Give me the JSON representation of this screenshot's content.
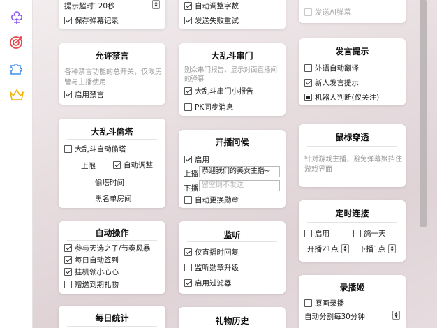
{
  "sidebar": {
    "icons": [
      "flower-icon",
      "target-icon",
      "puzzle-icon",
      "crown-icon"
    ]
  },
  "top_card_1": {
    "timeout_label": "提示超时120秒",
    "save_record": "保存弹幕记录"
  },
  "top_card_2": {
    "auto_adjust": "自动调整字数",
    "retry_failed": "发送失败重试"
  },
  "top_card_3": {
    "send_ai": "发送AI弹幕"
  },
  "allow_ban": {
    "title": "允许禁言",
    "desc": "各种禁言功能的总开关，仅限房管与主播使用",
    "enable": "启用禁言"
  },
  "chaos_door": {
    "title": "大乱斗串门",
    "desc": "别众串门报告、显示对面直播间的弹幕",
    "report": "大乱斗串门小报告",
    "pk_sync": "PK同步消息"
  },
  "speak_tip": {
    "title": "发言提示",
    "translate": "外语自动翻译",
    "new_user": "新人发言提示",
    "robot": "机器人判断(仅关注)"
  },
  "chaos_tower": {
    "title": "大乱斗偷塔",
    "auto": "大乱斗自动偷塔",
    "upper": "上限",
    "auto_adjust": "自动调整",
    "tower_time": "偷塔时间",
    "blacklist": "黑名单房间"
  },
  "greet": {
    "title": "开播问候",
    "enable": "启用",
    "up_label": "上播",
    "up_value": "恭迎我们的美女主播~",
    "down_label": "下播",
    "down_placeholder": "留空则不发送",
    "auto_medal": "自动更换勋章"
  },
  "mouse_through": {
    "title": "鼠标穿透",
    "desc": "针对游戏主播，避免弹幕姬挡住游戏界面"
  },
  "auto_ops": {
    "title": "自动操作",
    "lottery": "参与天选之子/节奏风暴",
    "sign": "每日自动签到",
    "hang": "挂机领小心心",
    "gift": "赠送到期礼物"
  },
  "listen": {
    "title": "监听",
    "live_only": "仅直播时回复",
    "medal_up": "监听勋章升级",
    "filter": "启用过滤器"
  },
  "timed_connect": {
    "title": "定时连接",
    "enable": "启用",
    "one_day": "鸽一天",
    "start": "开播21点",
    "end": "下播1点"
  },
  "record": {
    "title": "录播姬",
    "original": "原画录播",
    "split": "自动分割每30分钟"
  },
  "daily_stats": {
    "title": "每日统计"
  },
  "gift_history": {
    "title": "礼物历史"
  }
}
